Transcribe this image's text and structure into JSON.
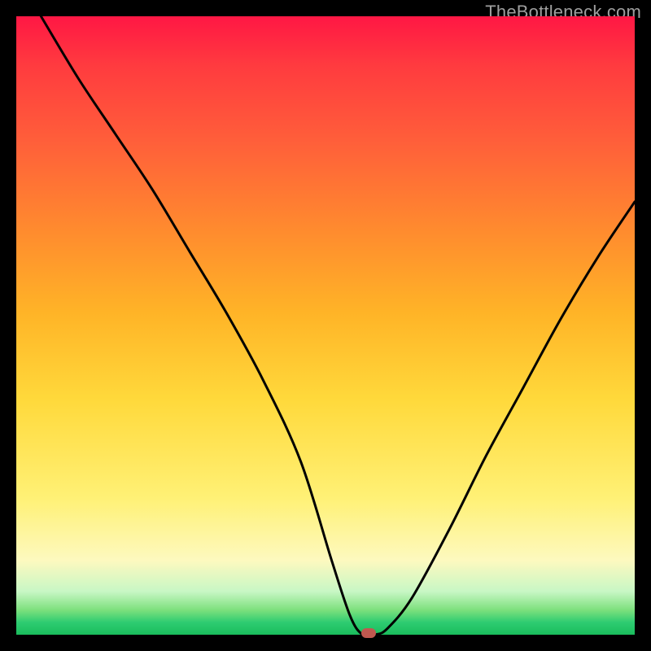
{
  "watermark": "TheBottleneck.com",
  "colors": {
    "frame": "#000000",
    "curve": "#000000",
    "marker": "#c0584f"
  },
  "chart_data": {
    "type": "line",
    "title": "",
    "xlabel": "",
    "ylabel": "",
    "xlim": [
      0,
      100
    ],
    "ylim": [
      0,
      100
    ],
    "grid": false,
    "legend": false,
    "series": [
      {
        "name": "bottleneck-curve",
        "x": [
          4,
          10,
          16,
          22,
          28,
          34,
          40,
          46,
          51,
          54,
          56,
          58,
          60,
          64,
          70,
          76,
          82,
          88,
          94,
          100
        ],
        "y": [
          100,
          90,
          81,
          72,
          62,
          52,
          41,
          28,
          12,
          3,
          0,
          0,
          1,
          6,
          17,
          29,
          40,
          51,
          61,
          70
        ]
      }
    ],
    "annotations": [
      {
        "name": "optimal-marker",
        "x": 57,
        "y": 0
      }
    ],
    "background": {
      "type": "vertical-gradient",
      "stops": [
        {
          "pos": 0.0,
          "color": "#ff1744"
        },
        {
          "pos": 0.35,
          "color": "#ff8c2e"
        },
        {
          "pos": 0.62,
          "color": "#ffd93b"
        },
        {
          "pos": 0.88,
          "color": "#fdf9bf"
        },
        {
          "pos": 0.96,
          "color": "#7de07d"
        },
        {
          "pos": 1.0,
          "color": "#1abc5c"
        }
      ]
    }
  }
}
